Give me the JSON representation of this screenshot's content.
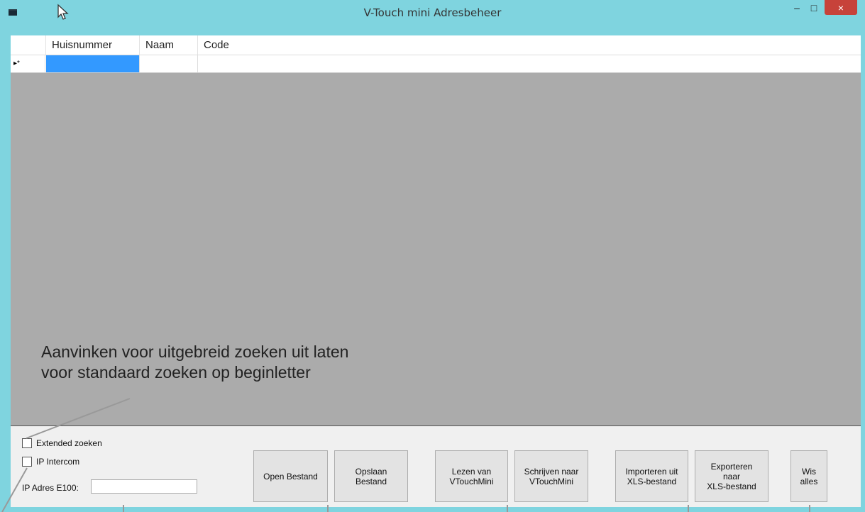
{
  "window": {
    "title": "V-Touch mini Adresbeheer",
    "minimize_glyph": "–",
    "maximize_glyph": "□",
    "close_glyph": "×"
  },
  "grid": {
    "columns": [
      "Huisnummer",
      "Naam",
      "Code"
    ],
    "new_row_marker": "▸*",
    "selection_color": "#3399ff"
  },
  "annotation": {
    "text": "Aanvinken voor uitgebreid zoeken uit laten voor standaard zoeken op beginletter"
  },
  "options": {
    "extended_search_label": "Extended zoeken",
    "ip_intercom_label": "IP Intercom",
    "ip_address_label": "IP Adres E100:",
    "ip_address_value": ""
  },
  "buttons": {
    "open_file": "Open Bestand",
    "save_file": "Opslaan\nBestand",
    "read_device": "Lezen van\nVTouchMini",
    "write_device": "Schrijven naar\nVTouchMini",
    "import_xls": "Importeren uit\nXLS-bestand",
    "export_xls": "Exporteren\nnaar\nXLS-bestand",
    "clear_all": "Wis\nalles"
  }
}
